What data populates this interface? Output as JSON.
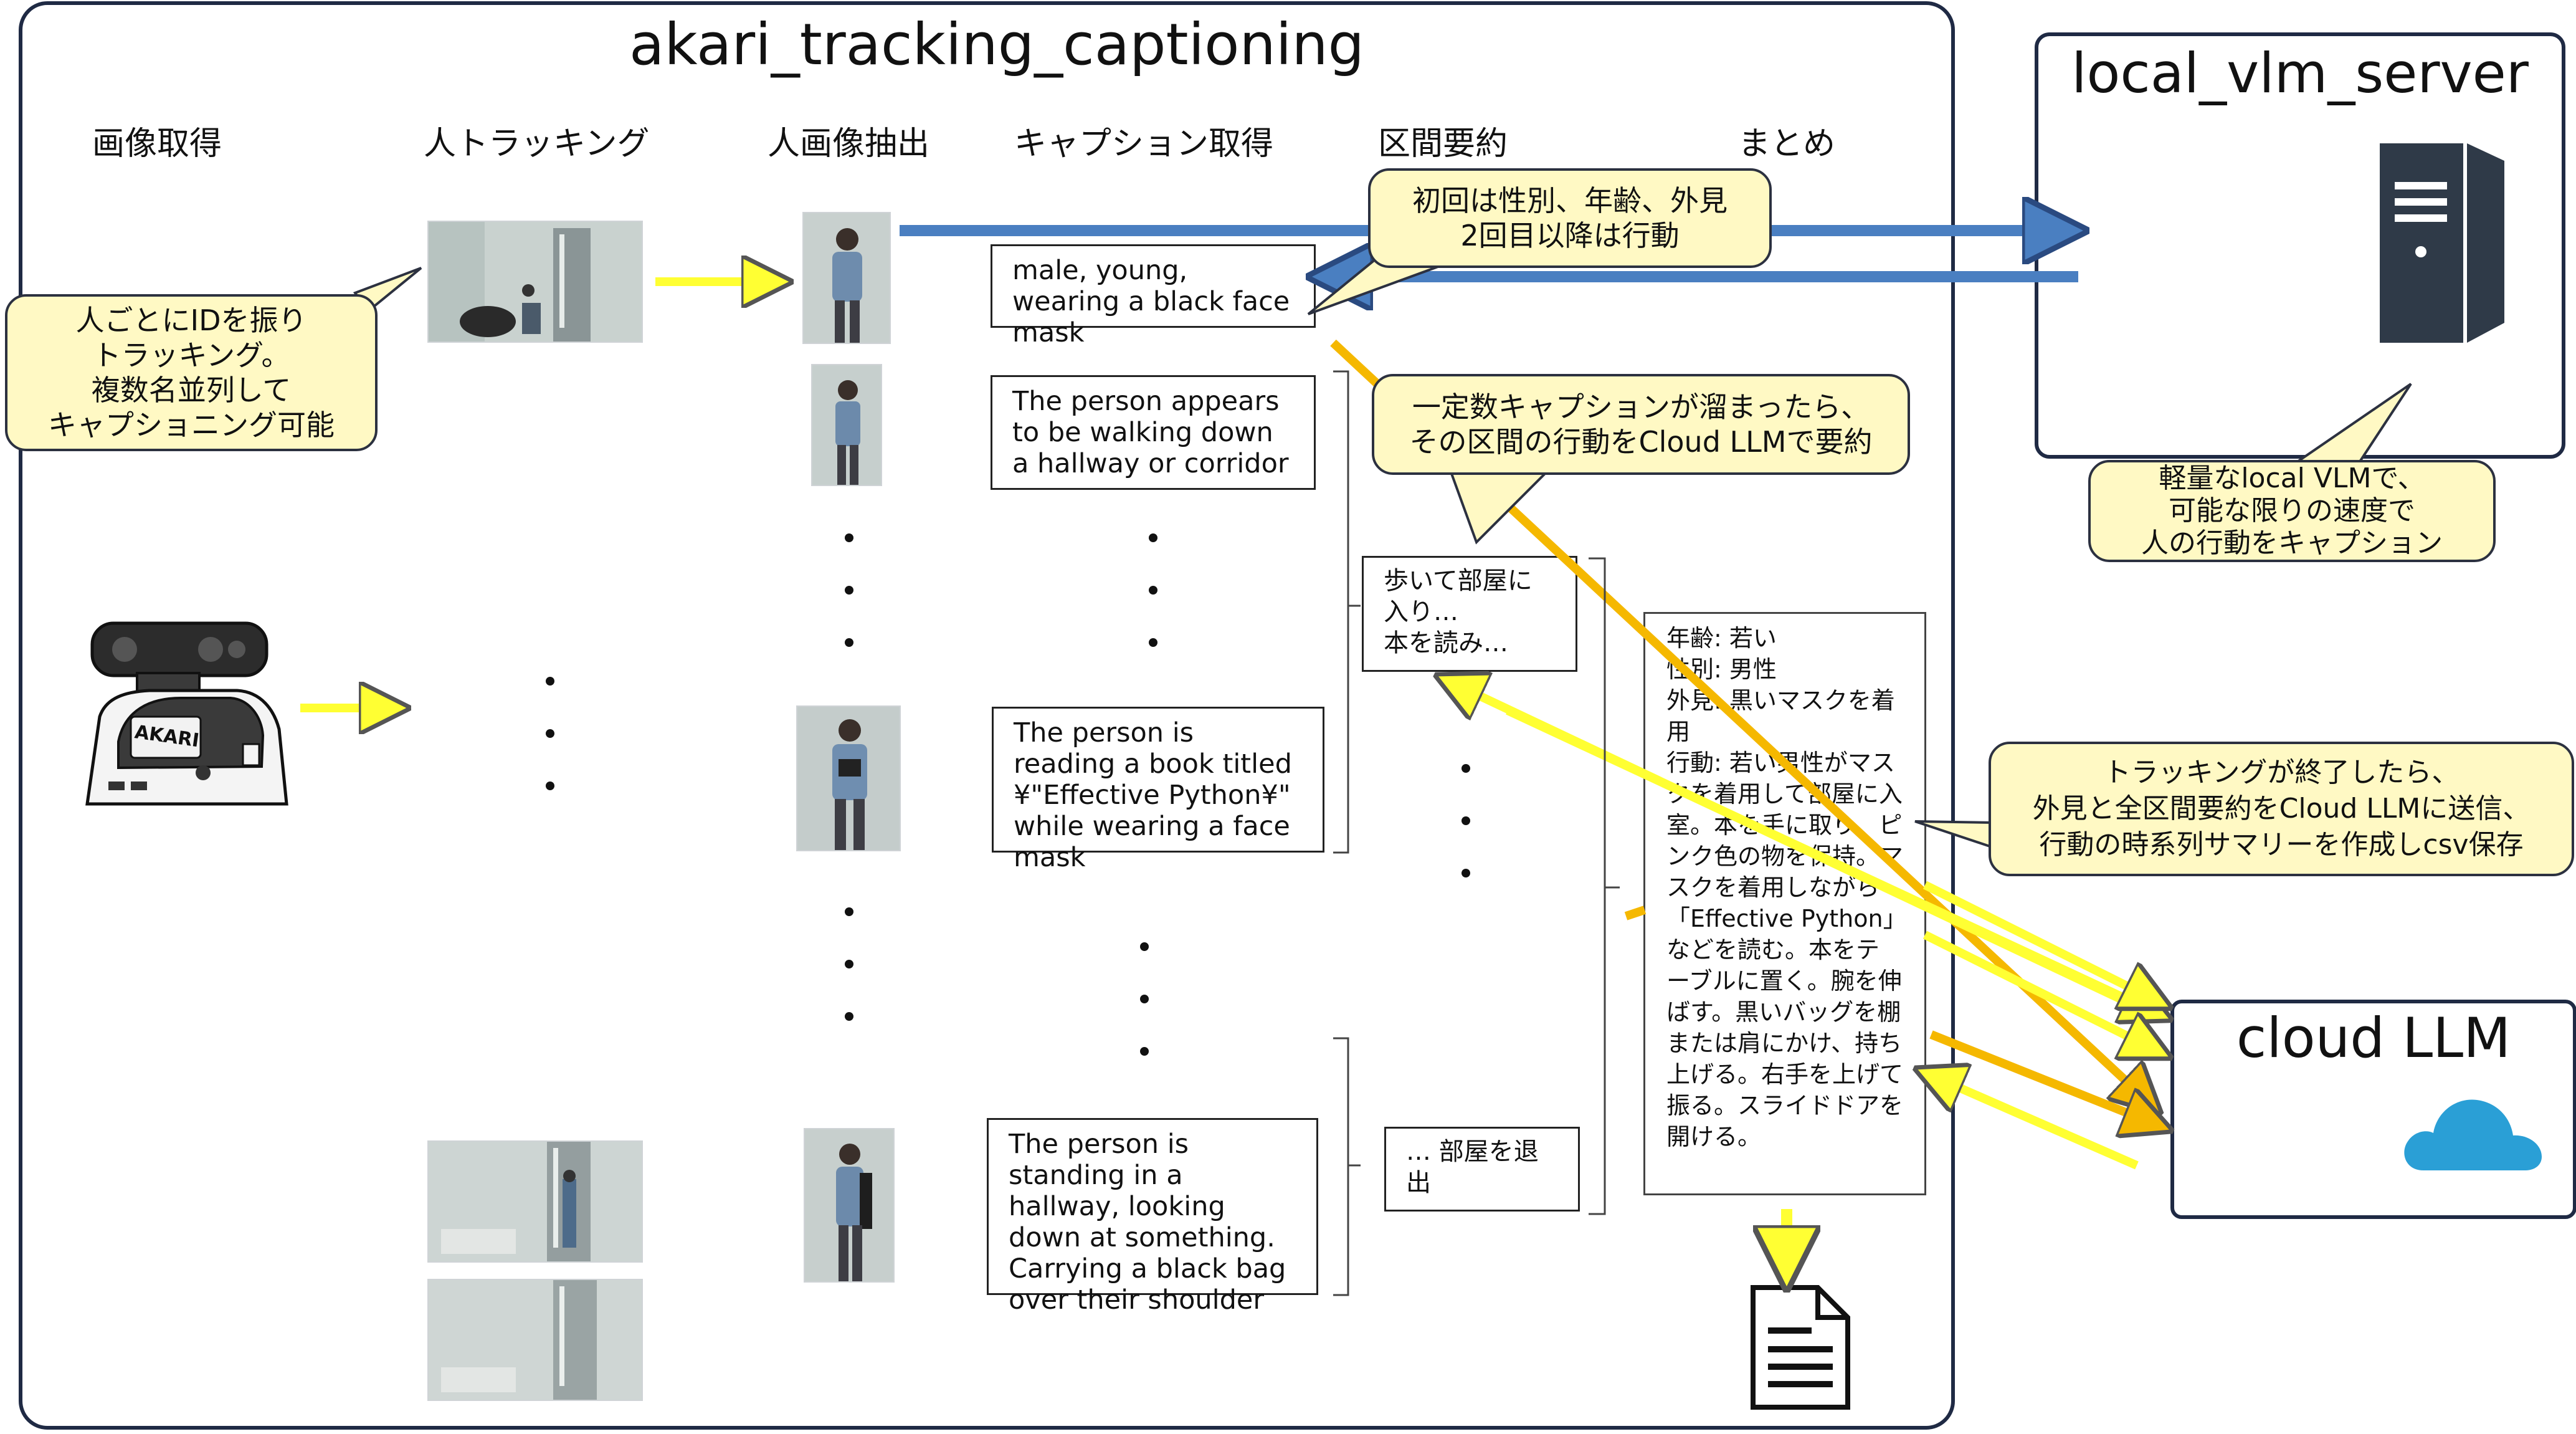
{
  "title": "akari_tracking_captioning",
  "column_headers": [
    "画像取得",
    "人トラッキング",
    "人画像抽出",
    "キャプション取得",
    "区間要約",
    "まとめ"
  ],
  "captions": [
    "male, young, wearing a black face mask",
    "The person appears to be walking down a hallway or corridor",
    "The person is reading a book titled ¥\"Effective Python¥\" while wearing a face mask",
    "The person is standing in a hallway, looking down at something. Carrying a black bag over their shoulder"
  ],
  "summaries": {
    "first": "歩いて部屋に入り…\n本を読み…",
    "last": "… 部屋を退出"
  },
  "final_summary": "年齢: 若い\n性別: 男性\n外見: 黒いマスクを着用\n行動: 若い男性がマスクを着用して部屋に入室。本を手に取り、ピンク色の物を保持。マスクを着用しながら「Effective Python」などを読む。本をテーブルに置く。腕を伸ばす。黒いバッグを棚または肩にかけ、持ち上げる。右手を上げて振る。スライドドアを開ける。",
  "notes": {
    "tracking": "人ごとにIDを振り\nトラッキング。\n複数名並列して\nキャプショニング可能",
    "first_time": "初回は性別、年齢、外見\n2回目以降は行動",
    "interval": "一定数キャプションが溜まったら、\nその区間の行動をCloud LLMで要約",
    "vlm": "軽量なlocal VLMで、\n可能な限りの速度で\n人の行動をキャプション",
    "end": "トラッキングが終了したら、\n外見と全区間要約をCloud LLMに送信、\n行動の時系列サマリーを作成しcsv保存"
  },
  "servers": {
    "local": "local_vlm_server",
    "cloud": "cloud LLM"
  },
  "robot_label": "AKARI",
  "icons": [
    "camera-robot-icon",
    "server-icon",
    "cloud-icon",
    "document-icon"
  ],
  "colors": {
    "frame": "#1f2a44",
    "note_fill": "#fff9c4",
    "arrow_yellow": "#ffff33",
    "arrow_orange": "#f5b800",
    "arrow_blue": "#4a7fc1",
    "cloud_blue": "#2a9fd6",
    "server_dark": "#2f3a48"
  }
}
